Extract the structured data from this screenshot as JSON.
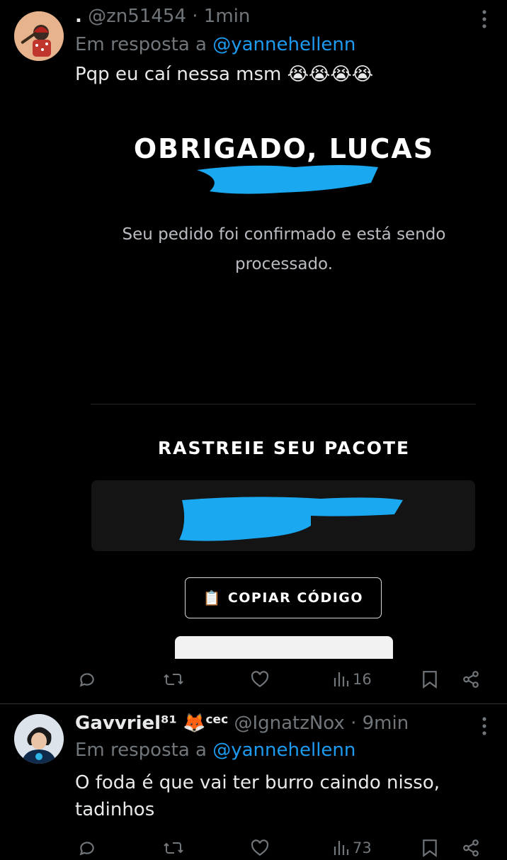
{
  "tweet1": {
    "display_name": ".",
    "handle": "@zn51454",
    "sep": "·",
    "time": "1min",
    "reply_prefix": "Em resposta a",
    "reply_to": "@yannehellenn",
    "text": "Pqp eu caí nessa msm 😭😭😭😭",
    "views": "16",
    "media": {
      "heading": "OBRIGADO, LUCAS",
      "confirmation_text": "Seu pedido foi confirmado e está sendo processado.",
      "tracking_heading": "RASTREIE SEU PACOTE",
      "copy_icon": "📋",
      "copy_label": "COPIAR CÓDIGO",
      "redaction_color": "#1aa8f0"
    }
  },
  "tweet2": {
    "display_name": "Gavvriel⁸¹",
    "badge_emoji": "🦊",
    "badge_suffix": "cec",
    "handle": "@IgnatzNox",
    "sep": "·",
    "time": "9min",
    "reply_prefix": "Em resposta a",
    "reply_to": "@yannehellenn",
    "text_line1": "O foda é que vai ter burro caindo nisso,",
    "text_line2": "tadinhos",
    "views": "73"
  },
  "icons": [
    "reply-icon",
    "retweet-icon",
    "like-icon",
    "views-icon",
    "bookmark-icon",
    "share-icon",
    "more-options-icon"
  ],
  "colors": {
    "background": "#000000",
    "text": "#e7e9ea",
    "muted": "#71767b",
    "link": "#1d9bf0"
  }
}
